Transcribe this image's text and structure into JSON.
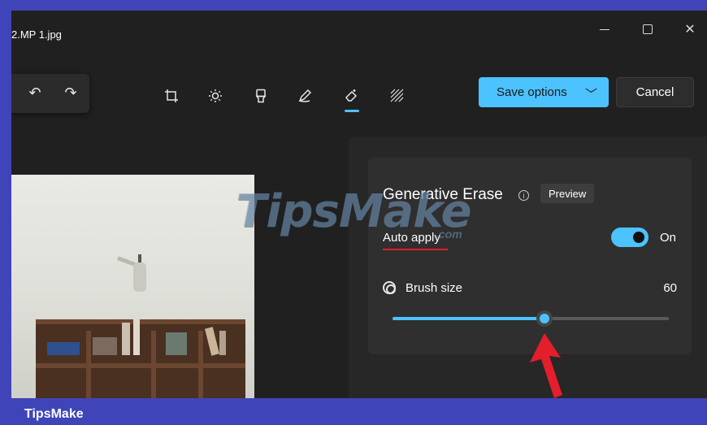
{
  "window": {
    "title": "2.MP 1.jpg",
    "controls": {
      "minimize": "",
      "maximize": "",
      "close": "✕"
    }
  },
  "toolbar": {
    "undo_icon": "↶",
    "redo_icon": "↷",
    "tools": [
      "crop-icon",
      "brightness-icon",
      "filter-icon",
      "markup-icon",
      "erase-icon",
      "background-blur-icon"
    ],
    "active_tool": "erase-icon",
    "save_label": "Save options",
    "save_chevron": "﹀",
    "cancel_label": "Cancel",
    "accent_color": "#4cc2ff"
  },
  "panel": {
    "title": "Generative Erase",
    "info_icon": "i",
    "badge": "Preview",
    "auto_apply_label": "Auto apply",
    "auto_apply_state": "On",
    "auto_apply_on": true,
    "brush_label": "Brush size",
    "brush_value": "60",
    "brush_level_fraction": 0.55
  },
  "watermark": {
    "text": "TipsMake",
    "sub": ".com"
  },
  "footer": {
    "brand": "TipsMake",
    "frame_color": "#3f45b8",
    "arrow_color": "#e21f2b"
  }
}
